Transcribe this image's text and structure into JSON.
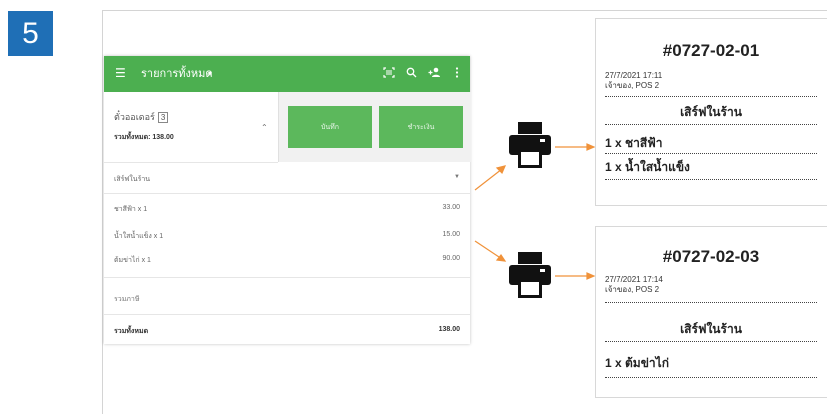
{
  "step": "5",
  "pos": {
    "header": {
      "menu_icon": "menu-icon",
      "title": "รายการทั้งหมด",
      "caret": "▾",
      "icons": [
        "barcode-scan-icon",
        "search-icon",
        "add-customer-icon",
        "more-vert-icon"
      ]
    },
    "summary": {
      "counter_label": "ตั๋วออเดอร์",
      "counter_value": "3",
      "total_label": "รวมทั้งหมด: 138.00"
    },
    "buttons": {
      "save": "บันทึก",
      "pay": "ชำระเงิน"
    },
    "dining_option": "เสิร์ฟในร้าน",
    "items": [
      {
        "name": "ชาสีฟ้า x 1",
        "price": "33.00"
      },
      {
        "name": "น้ำใสน้ำแข็ง x 1",
        "price": "15.00"
      },
      {
        "name": "ต้มข่าไก่ x 1",
        "price": "90.00"
      }
    ],
    "tax_label": "รวมภาษี",
    "grand_label": "รวมทั้งหมด",
    "grand_value": "138.00"
  },
  "receipts": [
    {
      "order_no": "#0727-02-01",
      "datetime": "27/7/2021 17:11",
      "staff": "เจ้าของ, POS 2",
      "service": "เสิร์ฟในร้าน",
      "items": [
        "1 x ชาสีฟ้า",
        "1 x น้ำใสน้ำแข็ง"
      ]
    },
    {
      "order_no": "#0727-02-03",
      "datetime": "27/7/2021 17:14",
      "staff": "เจ้าของ, POS 2",
      "service": "เสิร์ฟในร้าน",
      "items": [
        "1 x ต้มข่าไก่"
      ]
    }
  ],
  "colors": {
    "badge": "#1f6fb6",
    "header_green": "#4caf50",
    "button_green": "#5cb85c",
    "arrow_orange": "#f0923a"
  }
}
